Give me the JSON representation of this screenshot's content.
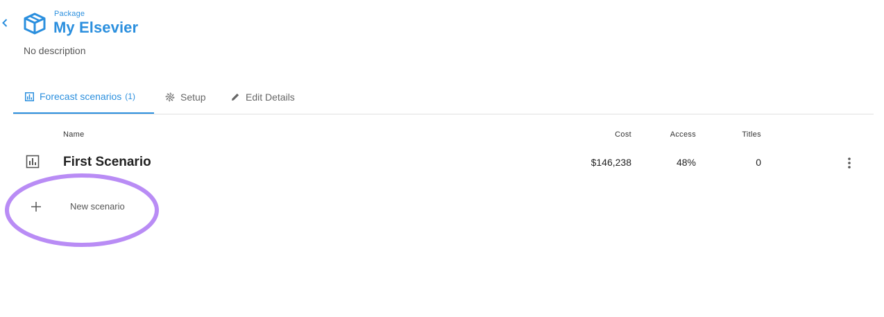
{
  "header": {
    "back_icon": "chevron-left-icon",
    "package_icon": "package-box-icon",
    "eyebrow": "Package",
    "title": "My Elsevier",
    "description": "No description"
  },
  "tabs": [
    {
      "label": "Forecast scenarios",
      "count": "(1)",
      "icon": "bar-chart-icon",
      "active": true
    },
    {
      "label": "Setup",
      "icon": "gear-icon",
      "active": false
    },
    {
      "label": "Edit Details",
      "icon": "pencil-icon",
      "active": false
    }
  ],
  "table": {
    "columns": {
      "name": "Name",
      "cost": "Cost",
      "access": "Access",
      "titles": "Titles"
    },
    "rows": [
      {
        "icon": "bar-chart-icon",
        "name": "First Scenario",
        "cost": "$146,238",
        "access": "48%",
        "titles": "0",
        "menu_icon": "more-vert-icon"
      }
    ]
  },
  "new_scenario": {
    "icon": "plus-icon",
    "label": "New scenario"
  },
  "colors": {
    "accent": "#2b8fde",
    "highlight": "#b98cf5"
  }
}
